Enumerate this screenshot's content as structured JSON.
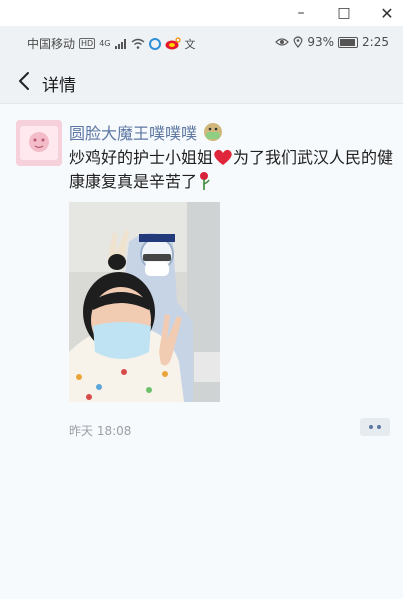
{
  "window": {
    "minimize_symbol": "–",
    "maximize_symbol": "□",
    "close_symbol": "✕"
  },
  "status_bar": {
    "carrier": "中国移动",
    "hd_badge": "HD",
    "network": "4G",
    "battery_percent": "93%",
    "battery_level": 0.93,
    "time": "2:25",
    "icons": [
      "signal-icon",
      "wifi-icon",
      "app-icon",
      "weibo-icon",
      "text-icon",
      "eye-icon",
      "location-icon",
      "battery-icon"
    ]
  },
  "nav": {
    "back_icon": "chevron-left-icon",
    "title": "详情"
  },
  "post": {
    "username": "圆脸大魔王噗噗噗",
    "text_part1": "炒鸡好的护士小姐姐",
    "text_part2": "为了我们武汉人民的健康康复真是辛苦了",
    "emoji_after_name": "mask-face-emoji",
    "emoji_heart": "red-heart-emoji",
    "emoji_flower": "rose-emoji",
    "photo": "selfie-with-nurse-in-protective-suit",
    "timestamp": "昨天 18:08"
  },
  "colors": {
    "link_blue": "#5e77a4",
    "background": "#f7fafc",
    "heart": "#e0263a"
  }
}
